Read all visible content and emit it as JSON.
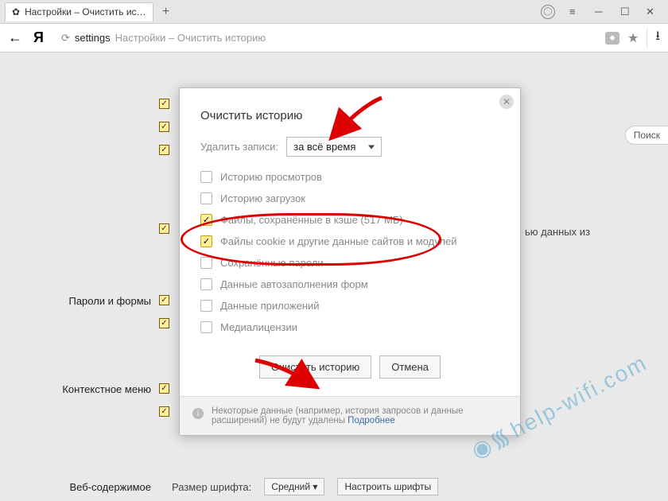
{
  "tab": {
    "title": "Настройки – Очистить ис…"
  },
  "addressbar": {
    "prefix": "settings",
    "suffix": "Настройки – Очистить историю"
  },
  "bg": {
    "search": "Поиск",
    "section_passwords": "Пароли и формы",
    "section_context": "Контекстное меню",
    "section_web": "Веб-содержимое",
    "right_text_fragment": "ью данных из",
    "font_size_label": "Размер шрифта:",
    "font_size_value": "Средний",
    "customize_fonts": "Настроить шрифты"
  },
  "dialog": {
    "title": "Очистить историю",
    "range_label": "Удалить записи:",
    "range_value": "за всё время",
    "items": {
      "history": "Историю просмотров",
      "downloads": "Историю загрузок",
      "cache": "Файлы, сохранённые в кэше (517 МБ)",
      "cookies": "Файлы cookie и другие данные сайтов и модулей",
      "passwords": "Сохранённые пароли",
      "autofill": "Данные автозаполнения форм",
      "appdata": "Данные приложений",
      "media": "Медиалицензии"
    },
    "btn_clear": "Очистить историю",
    "btn_cancel": "Отмена",
    "footer_text": "Некоторые данные (например, история запросов и данные расширений) не будут удалены ",
    "footer_link": "Подробнее"
  },
  "watermark": "help-wifi.com"
}
